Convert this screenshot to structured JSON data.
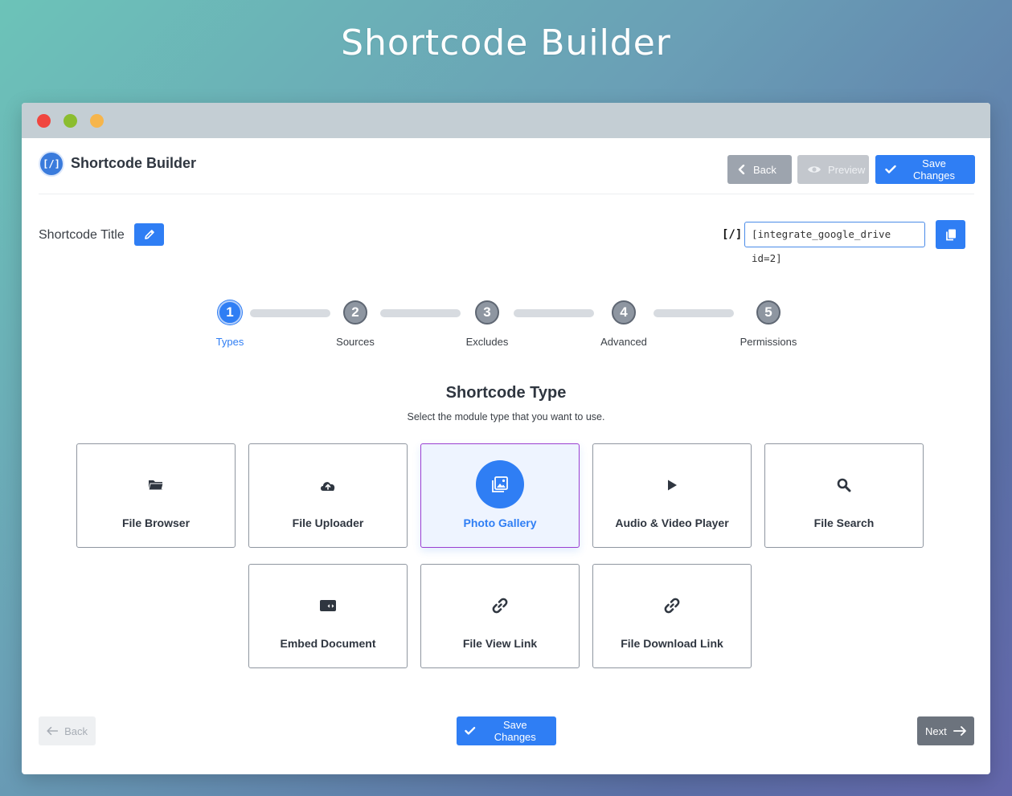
{
  "page": {
    "heading": "Shortcode Builder"
  },
  "window": {
    "controls": [
      "close",
      "minimize",
      "maximize"
    ]
  },
  "header": {
    "app_title": "Shortcode Builder",
    "logo_text": "[/]",
    "back_label": "Back",
    "preview_label": "Preview",
    "save_label": "Save Changes"
  },
  "title_row": {
    "label": "Shortcode Title",
    "code_icon": "[/]",
    "shortcode_value": "[integrate_google_drive id=2]"
  },
  "steps": [
    {
      "number": "1",
      "label": "Types",
      "active": true
    },
    {
      "number": "2",
      "label": "Sources",
      "active": false
    },
    {
      "number": "3",
      "label": "Excludes",
      "active": false
    },
    {
      "number": "4",
      "label": "Advanced",
      "active": false
    },
    {
      "number": "5",
      "label": "Permissions",
      "active": false
    }
  ],
  "section": {
    "title": "Shortcode Type",
    "subtitle": "Select the module type that you want to use."
  },
  "types": [
    {
      "label": "File Browser",
      "icon": "folder-icon",
      "selected": false
    },
    {
      "label": "File Uploader",
      "icon": "cloud-upload-icon",
      "selected": false
    },
    {
      "label": "Photo Gallery",
      "icon": "gallery-icon",
      "selected": true
    },
    {
      "label": "Audio & Video Player",
      "icon": "play-icon",
      "selected": false
    },
    {
      "label": "File Search",
      "icon": "search-icon",
      "selected": false
    },
    {
      "label": "Embed Document",
      "icon": "embed-icon",
      "selected": false
    },
    {
      "label": "File View Link",
      "icon": "link-icon",
      "selected": false
    },
    {
      "label": "File Download Link",
      "icon": "link-icon",
      "selected": false
    }
  ],
  "footer": {
    "back_label": "Back",
    "save_label": "Save Changes",
    "next_label": "Next"
  },
  "colors": {
    "accent": "#2f7ef4",
    "selected_border": "#9a3fd1",
    "inactive_step": "#8e96a1"
  }
}
